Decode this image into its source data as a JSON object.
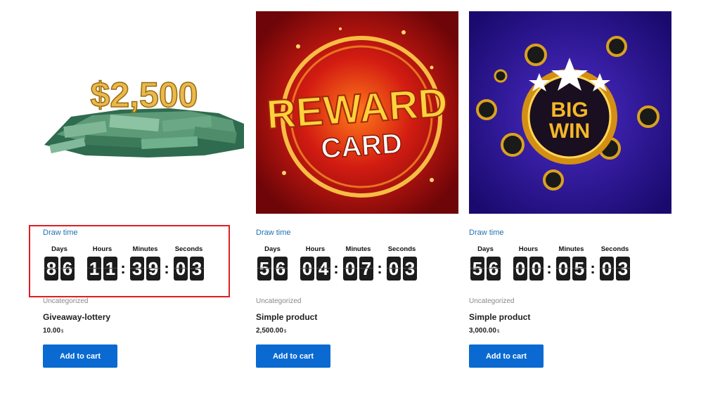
{
  "products": [
    {
      "image_caption": "$2,500",
      "draw_time_label": "Draw time",
      "countdown": {
        "days": "86",
        "hours": "11",
        "minutes": "39",
        "seconds": "03"
      },
      "category": "Uncategorized",
      "title": "Giveaway-lottery",
      "price": "10.00",
      "currency": "$",
      "cart_label": "Add to cart"
    },
    {
      "image_caption_line1": "REWARD",
      "image_caption_line2": "CARD",
      "draw_time_label": "Draw time",
      "countdown": {
        "days": "56",
        "hours": "04",
        "minutes": "07",
        "seconds": "03"
      },
      "category": "Uncategorized",
      "title": "Simple product",
      "price": "2,500.00",
      "currency": "$",
      "cart_label": "Add to cart"
    },
    {
      "image_caption_line1": "BIG",
      "image_caption_line2": "WIN",
      "draw_time_label": "Draw time",
      "countdown": {
        "days": "56",
        "hours": "00",
        "minutes": "05",
        "seconds": "03"
      },
      "category": "Uncategorized",
      "title": "Simple product",
      "price": "3,000.00",
      "currency": "$",
      "cart_label": "Add to cart"
    }
  ],
  "labels": {
    "days": "Days",
    "hours": "Hours",
    "minutes": "Minutes",
    "seconds": "Seconds"
  },
  "colors": {
    "link": "#2271b1",
    "button": "#0a6ad1",
    "highlight": "#e01d24",
    "digit_bg": "#1c1c1c"
  }
}
